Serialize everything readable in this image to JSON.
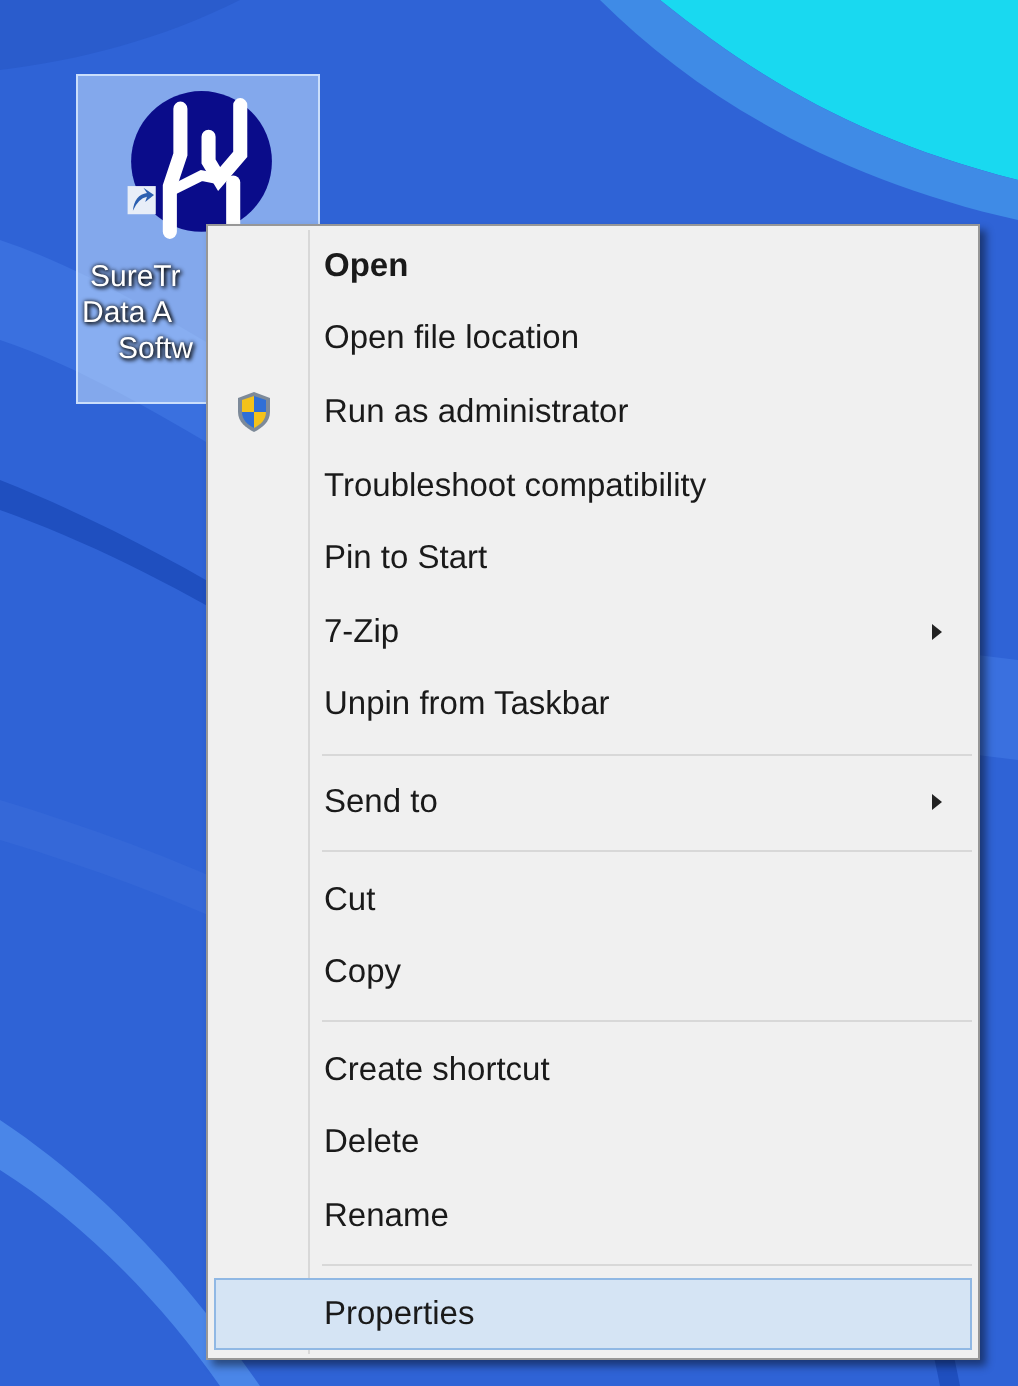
{
  "desktop_icon": {
    "label_lines": [
      "SureTr",
      "Data A",
      "Softw"
    ],
    "selected": true
  },
  "context_menu": {
    "items": [
      {
        "kind": "item",
        "label": "Open",
        "bold": true,
        "submenu": false,
        "selected": false
      },
      {
        "kind": "item",
        "label": "Open file location",
        "bold": false,
        "submenu": false,
        "selected": false
      },
      {
        "kind": "admin",
        "label": "Run as administrator",
        "bold": false,
        "submenu": false,
        "selected": false
      },
      {
        "kind": "item",
        "label": "Troubleshoot compatibility",
        "bold": false,
        "submenu": false,
        "selected": false
      },
      {
        "kind": "item",
        "label": "Pin to Start",
        "bold": false,
        "submenu": false,
        "selected": false
      },
      {
        "kind": "item",
        "label": "7-Zip",
        "bold": false,
        "submenu": true,
        "selected": false
      },
      {
        "kind": "item",
        "label": "Unpin from Taskbar",
        "bold": false,
        "submenu": false,
        "selected": false
      },
      {
        "kind": "separator"
      },
      {
        "kind": "item",
        "label": "Send to",
        "bold": false,
        "submenu": true,
        "selected": false
      },
      {
        "kind": "separator"
      },
      {
        "kind": "item",
        "label": "Cut",
        "bold": false,
        "submenu": false,
        "selected": false
      },
      {
        "kind": "item",
        "label": "Copy",
        "bold": false,
        "submenu": false,
        "selected": false
      },
      {
        "kind": "separator"
      },
      {
        "kind": "item",
        "label": "Create shortcut",
        "bold": false,
        "submenu": false,
        "selected": false
      },
      {
        "kind": "item",
        "label": "Delete",
        "bold": false,
        "submenu": false,
        "selected": false
      },
      {
        "kind": "item",
        "label": "Rename",
        "bold": false,
        "submenu": false,
        "selected": false
      },
      {
        "kind": "separator"
      },
      {
        "kind": "item",
        "label": "Properties",
        "bold": false,
        "submenu": false,
        "selected": true
      }
    ]
  }
}
